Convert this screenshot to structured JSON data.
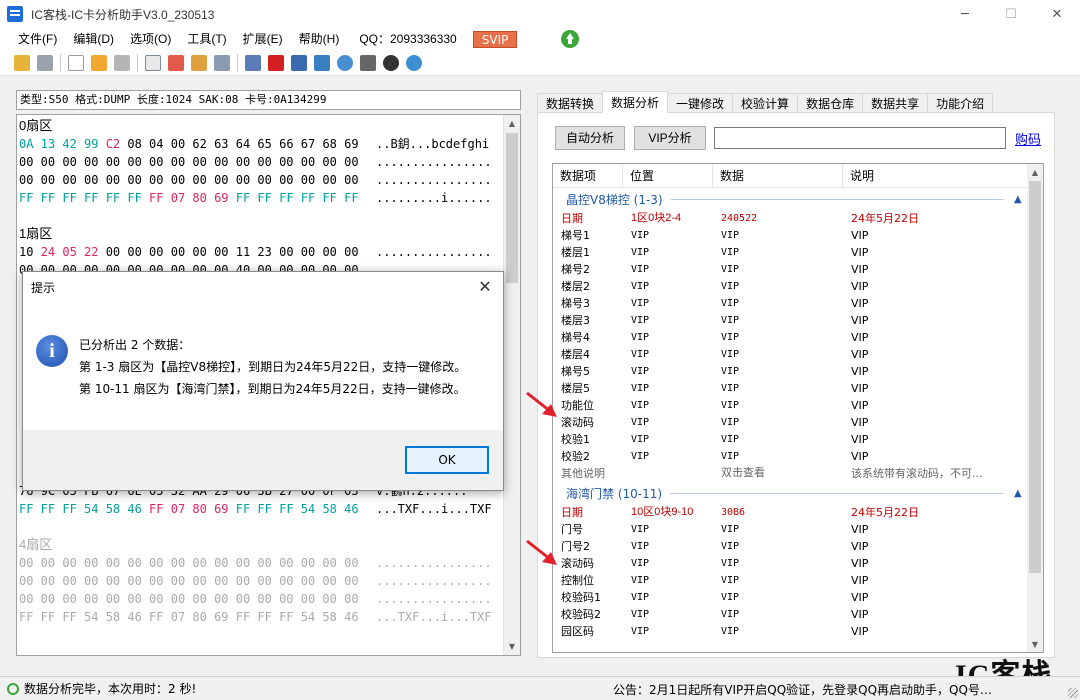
{
  "window": {
    "title": "IC客栈-IC卡分析助手V3.0_230513",
    "minimize": "─",
    "maximize": "☐",
    "close": "✕"
  },
  "menu": {
    "items": [
      "文件(F)",
      "编辑(D)",
      "选项(O)",
      "工具(T)",
      "扩展(E)",
      "帮助(H)"
    ],
    "qq": "QQ：2093336330",
    "svip": "SVIP"
  },
  "card_info": "类型:S50 格式:DUMP 长度:1024 SAK:08 卡号:0A134299",
  "hex": {
    "sectors": [
      {
        "title": "0扇区",
        "rows": [
          {
            "bytes": "0A 13 42 99 C2 08 04 00 62 63 64 65 66 67 68 69",
            "ascii": "..B鈅...bcdefghi"
          },
          {
            "bytes": "00 00 00 00 00 00 00 00 00 00 00 00 00 00 00 00",
            "ascii": "................"
          },
          {
            "bytes": "00 00 00 00 00 00 00 00 00 00 00 00 00 00 00 00",
            "ascii": "................"
          },
          {
            "bytes": "FF FF FF FF FF FF FF 07 80 69 FF FF FF FF FF FF",
            "ascii": "...........i......"
          }
        ]
      },
      {
        "title": "1扇区",
        "rows": [
          {
            "bytes": "10 24 05 22 00 00 00 00 00 00 11 23 00 00 00 00",
            "ascii": "................"
          },
          {
            "bytes": "00 00 00 00 00 00 00 00 00 00 40 00 00 00 00 00",
            "ascii": "................"
          }
        ]
      }
    ],
    "sector3_tail": [
      {
        "bytes": "76 9C 05 FB 67 6E 05 32 AA 29 06 3B 27 00 0F 03",
        "ascii": "v.鶴n.2......"
      },
      {
        "bytes": "FF FF FF 54 58 46 FF 07 80 69 FF FF FF 54 58 46",
        "ascii": "...TXF...i...TXF"
      }
    ],
    "sector4": {
      "title": "4扇区",
      "rows": [
        {
          "bytes": "00 00 00 00 00 00 00 00 00 00 00 00 00 00 00 00",
          "ascii": "................"
        },
        {
          "bytes": "00 00 00 00 00 00 00 00 00 00 00 00 00 00 00 00",
          "ascii": "................"
        },
        {
          "bytes": "00 00 00 00 00 00 00 00 00 00 00 00 00 00 00 00",
          "ascii": "................"
        },
        {
          "bytes": "FF FF FF 54 58 46 FF 07 80 69 FF FF FF 54 58 46",
          "ascii": "...TXF...i...TXF"
        }
      ]
    }
  },
  "tabs": [
    "数据转换",
    "数据分析",
    "一键修改",
    "校验计算",
    "数据仓库",
    "数据共享",
    "功能介绍"
  ],
  "active_tab": "数据分析",
  "analysis": {
    "auto_button": "自动分析",
    "vip_button": "VIP分析",
    "vip_input_value": "",
    "buy_link": "购码",
    "columns": [
      "数据项",
      "位置",
      "数据",
      "说明"
    ],
    "groups": [
      {
        "title": "晶控V8梯控 (1-3)",
        "rows": [
          {
            "item": "日期",
            "pos": "1区0块2-4",
            "data": "240522",
            "desc": "24年5月22日",
            "style": "red"
          },
          {
            "item": "梯号1",
            "pos": "VIP",
            "data": "VIP",
            "desc": "VIP",
            "style": ""
          },
          {
            "item": "楼层1",
            "pos": "VIP",
            "data": "VIP",
            "desc": "VIP",
            "style": ""
          },
          {
            "item": "梯号2",
            "pos": "VIP",
            "data": "VIP",
            "desc": "VIP",
            "style": ""
          },
          {
            "item": "楼层2",
            "pos": "VIP",
            "data": "VIP",
            "desc": "VIP",
            "style": ""
          },
          {
            "item": "梯号3",
            "pos": "VIP",
            "data": "VIP",
            "desc": "VIP",
            "style": ""
          },
          {
            "item": "楼层3",
            "pos": "VIP",
            "data": "VIP",
            "desc": "VIP",
            "style": ""
          },
          {
            "item": "梯号4",
            "pos": "VIP",
            "data": "VIP",
            "desc": "VIP",
            "style": ""
          },
          {
            "item": "楼层4",
            "pos": "VIP",
            "data": "VIP",
            "desc": "VIP",
            "style": ""
          },
          {
            "item": "梯号5",
            "pos": "VIP",
            "data": "VIP",
            "desc": "VIP",
            "style": ""
          },
          {
            "item": "楼层5",
            "pos": "VIP",
            "data": "VIP",
            "desc": "VIP",
            "style": ""
          },
          {
            "item": "功能位",
            "pos": "VIP",
            "data": "VIP",
            "desc": "VIP",
            "style": ""
          },
          {
            "item": "滚动码",
            "pos": "VIP",
            "data": "VIP",
            "desc": "VIP",
            "style": ""
          },
          {
            "item": "校验1",
            "pos": "VIP",
            "data": "VIP",
            "desc": "VIP",
            "style": ""
          },
          {
            "item": "校验2",
            "pos": "VIP",
            "data": "VIP",
            "desc": "VIP",
            "style": ""
          },
          {
            "item": "其他说明",
            "pos": "",
            "data": "双击查看",
            "desc": "该系统带有滚动码，不可...",
            "style": "gray"
          }
        ]
      },
      {
        "title": "海湾门禁 (10-11)",
        "rows": [
          {
            "item": "日期",
            "pos": "10区0块9-10",
            "data": "30B6",
            "desc": "24年5月22日",
            "style": "red"
          },
          {
            "item": "门号",
            "pos": "VIP",
            "data": "VIP",
            "desc": "VIP",
            "style": ""
          },
          {
            "item": "门号2",
            "pos": "VIP",
            "data": "VIP",
            "desc": "VIP",
            "style": ""
          },
          {
            "item": "滚动码",
            "pos": "VIP",
            "data": "VIP",
            "desc": "VIP",
            "style": ""
          },
          {
            "item": "控制位",
            "pos": "VIP",
            "data": "VIP",
            "desc": "VIP",
            "style": ""
          },
          {
            "item": "校验码1",
            "pos": "VIP",
            "data": "VIP",
            "desc": "VIP",
            "style": ""
          },
          {
            "item": "校验码2",
            "pos": "VIP",
            "data": "VIP",
            "desc": "VIP",
            "style": ""
          },
          {
            "item": "园区码",
            "pos": "VIP",
            "data": "VIP",
            "desc": "VIP",
            "style": ""
          }
        ]
      }
    ]
  },
  "dialog": {
    "title": "提示",
    "line1": "已分析出 2 个数据：",
    "line2": "第 1-3 扇区为【晶控V8梯控】，到期日为24年5月22日，支持一键修改。",
    "line3": "第 10-11 扇区为【海湾门禁】，到期日为24年5月22日，支持一键修改。",
    "ok": "OK"
  },
  "status": {
    "text": "数据分析完毕，本次用时：2 秒!",
    "notice": "公告：2月1日起所有VIP开启QQ验证，先登录QQ再启动助手，QQ号…"
  },
  "watermark": "IC客栈",
  "colors": {
    "red_text": "#c00000",
    "group_title": "#1f5aa8",
    "svip_bg": "#e8704b",
    "hex_red": "#e0245e",
    "hex_cyan": "#00a0a0",
    "arrow_red": "#e0202a"
  }
}
